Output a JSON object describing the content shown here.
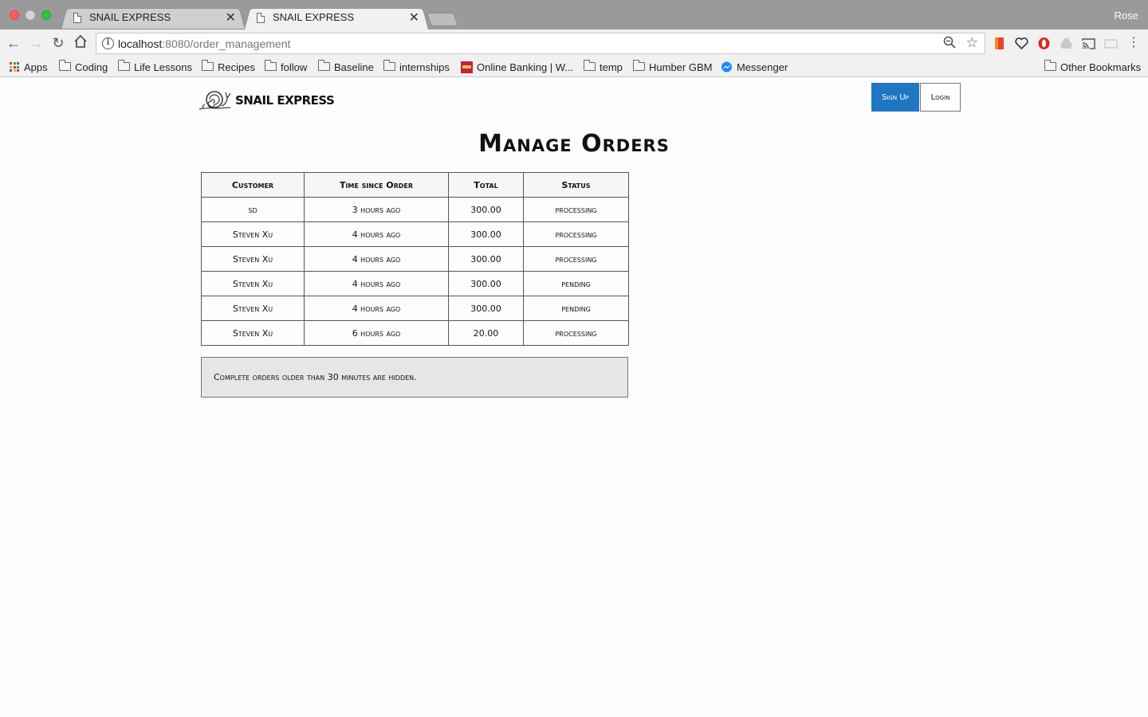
{
  "browser": {
    "tabs": [
      {
        "title": "SNAIL EXPRESS",
        "close": "✕"
      },
      {
        "title": "SNAIL EXPRESS",
        "close": "✕"
      }
    ],
    "profile_name": "Rose",
    "url_host": "localhost",
    "url_rest": ":8080/order_management",
    "bookmarks": [
      {
        "label": "Apps",
        "icon": "apps-grid-icon"
      },
      {
        "label": "Coding",
        "icon": "folder-icon"
      },
      {
        "label": "Life Lessons",
        "icon": "folder-icon"
      },
      {
        "label": "Recipes",
        "icon": "folder-icon"
      },
      {
        "label": "follow",
        "icon": "folder-icon"
      },
      {
        "label": "Baseline",
        "icon": "folder-icon"
      },
      {
        "label": "internships",
        "icon": "folder-icon"
      },
      {
        "label": "Online Banking | W...",
        "icon": "cibc-icon"
      },
      {
        "label": "temp",
        "icon": "folder-icon"
      },
      {
        "label": "Humber GBM",
        "icon": "folder-icon"
      },
      {
        "label": "Messenger",
        "icon": "messenger-icon"
      },
      {
        "label": "Other Bookmarks",
        "icon": "folder-icon"
      }
    ],
    "colors": {
      "messenger": "#1e88ff",
      "cibc": "#c41f3e",
      "opera": "#e2261d"
    }
  },
  "header": {
    "brand": "SNAIL EXPRESS",
    "signup_label": "Sign Up",
    "login_label": "Login",
    "accent": "#1f76c2"
  },
  "main": {
    "title": "Manage Orders",
    "columns": [
      "Customer",
      "Time since Order",
      "Total",
      "Status"
    ],
    "rows": [
      {
        "customer": "sd",
        "time": "3 hours ago",
        "total": "300.00",
        "status": "processing"
      },
      {
        "customer": "Steven Xu",
        "time": "4 hours ago",
        "total": "300.00",
        "status": "processing"
      },
      {
        "customer": "Steven Xu",
        "time": "4 hours ago",
        "total": "300.00",
        "status": "processing"
      },
      {
        "customer": "Steven Xu",
        "time": "4 hours ago",
        "total": "300.00",
        "status": "pending"
      },
      {
        "customer": "Steven Xu",
        "time": "4 hours ago",
        "total": "300.00",
        "status": "pending"
      },
      {
        "customer": "Steven Xu",
        "time": "6 hours ago",
        "total": "20.00",
        "status": "processing"
      }
    ],
    "note": "Complete orders older than 30 minutes are hidden."
  }
}
